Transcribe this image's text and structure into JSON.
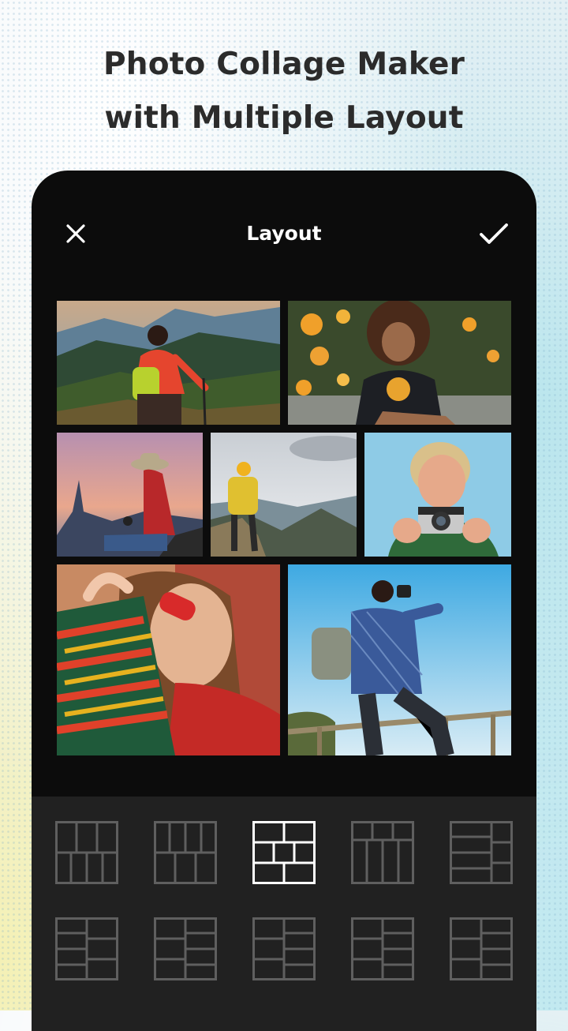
{
  "promo": {
    "headline_line1": "Photo Collage Maker",
    "headline_line2": "with Multiple Layout"
  },
  "header": {
    "title": "Layout",
    "close_icon": "close-icon",
    "confirm_icon": "checkmark-icon"
  },
  "collage": {
    "photos": [
      {
        "subject": "hiker-valley"
      },
      {
        "subject": "woman-flowers"
      },
      {
        "subject": "woman-sunset-hat"
      },
      {
        "subject": "hiker-mountain-ridge"
      },
      {
        "subject": "man-camera"
      },
      {
        "subject": "woman-red-sunglasses"
      },
      {
        "subject": "man-photographer-fence"
      }
    ]
  },
  "layout_picker": {
    "selected_index": 2,
    "options": [
      "layout-1",
      "layout-2",
      "layout-3",
      "layout-4",
      "layout-5",
      "layout-6",
      "layout-7",
      "layout-8",
      "layout-9",
      "layout-10"
    ]
  },
  "colors": {
    "panel_bg": "#0c0c0c",
    "tray_bg": "#212121",
    "layout_icon": "#5f5f5f",
    "layout_icon_selected": "#ffffff"
  }
}
